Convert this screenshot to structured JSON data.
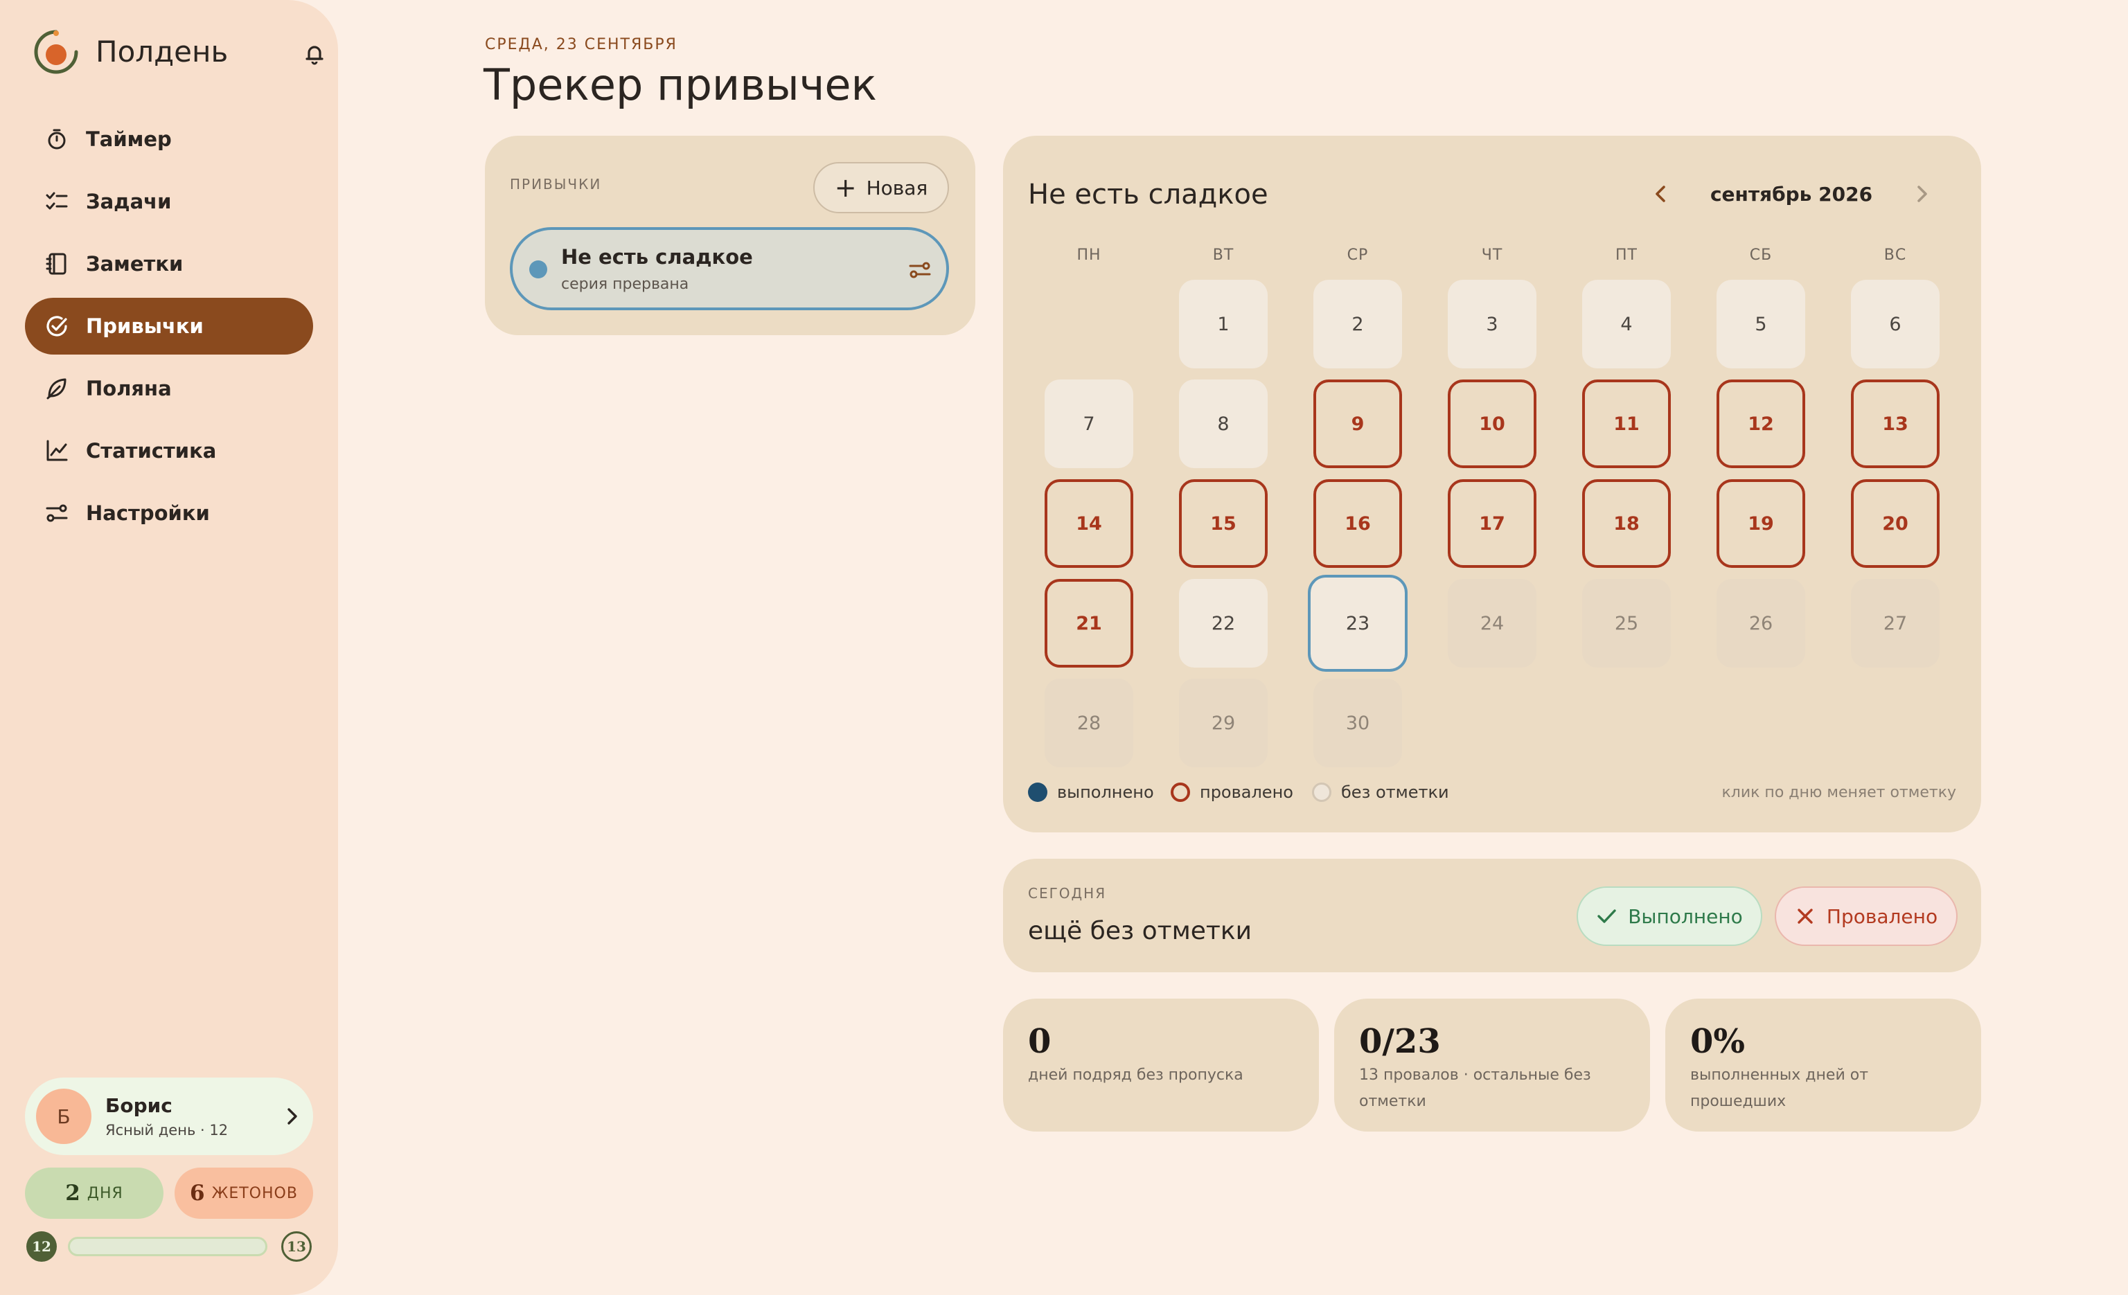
{
  "sidebar": {
    "brand": "Полдень",
    "nav": [
      {
        "label": "Таймер",
        "icon": "stopwatch-icon",
        "active": false
      },
      {
        "label": "Задачи",
        "icon": "checklist-icon",
        "active": false
      },
      {
        "label": "Заметки",
        "icon": "notebook-icon",
        "active": false
      },
      {
        "label": "Привычки",
        "icon": "check-circle-icon",
        "active": true
      },
      {
        "label": "Поляна",
        "icon": "leaf-icon",
        "active": false
      },
      {
        "label": "Статистика",
        "icon": "line-chart-icon",
        "active": false
      },
      {
        "label": "Настройки",
        "icon": "sliders-icon",
        "active": false
      }
    ],
    "user": {
      "initial": "Б",
      "name": "Борис",
      "subtitle": "Ясный день · 12"
    },
    "streak": {
      "number": "2",
      "label": "дня"
    },
    "tokens": {
      "number": "6",
      "label": "жетонов"
    },
    "level": {
      "current": "12",
      "next": "13",
      "progress": 0.0
    }
  },
  "header": {
    "date": "Среда, 23 сентября",
    "title": "Трекер привычек"
  },
  "habits": {
    "caption": "Привычки",
    "new_button": "Новая",
    "items": [
      {
        "name": "Не есть сладкое",
        "status": "серия прервана"
      }
    ]
  },
  "calendar": {
    "habit": "Не есть сладкое",
    "month": "сентябрь 2026",
    "weekdays": [
      "пн",
      "вт",
      "ср",
      "чт",
      "пт",
      "сб",
      "вс"
    ],
    "first_weekday_offset": 1,
    "days": [
      {
        "d": "1",
        "state": "none"
      },
      {
        "d": "2",
        "state": "none"
      },
      {
        "d": "3",
        "state": "none"
      },
      {
        "d": "4",
        "state": "none"
      },
      {
        "d": "5",
        "state": "none"
      },
      {
        "d": "6",
        "state": "none"
      },
      {
        "d": "7",
        "state": "none"
      },
      {
        "d": "8",
        "state": "none"
      },
      {
        "d": "9",
        "state": "failed"
      },
      {
        "d": "10",
        "state": "failed"
      },
      {
        "d": "11",
        "state": "failed"
      },
      {
        "d": "12",
        "state": "failed"
      },
      {
        "d": "13",
        "state": "failed"
      },
      {
        "d": "14",
        "state": "failed"
      },
      {
        "d": "15",
        "state": "failed"
      },
      {
        "d": "16",
        "state": "failed"
      },
      {
        "d": "17",
        "state": "failed"
      },
      {
        "d": "18",
        "state": "failed"
      },
      {
        "d": "19",
        "state": "failed"
      },
      {
        "d": "20",
        "state": "failed"
      },
      {
        "d": "21",
        "state": "failed"
      },
      {
        "d": "22",
        "state": "none"
      },
      {
        "d": "23",
        "state": "today"
      },
      {
        "d": "24",
        "state": "future"
      },
      {
        "d": "25",
        "state": "future"
      },
      {
        "d": "26",
        "state": "future"
      },
      {
        "d": "27",
        "state": "future"
      },
      {
        "d": "28",
        "state": "future"
      },
      {
        "d": "29",
        "state": "future"
      },
      {
        "d": "30",
        "state": "future"
      }
    ],
    "legend": {
      "done": "выполнено",
      "failed": "провалено",
      "none": "без отметки",
      "hint": "клик по дню меняет отметку"
    }
  },
  "today": {
    "caption": "Сегодня",
    "status": "ещё без отметки",
    "done_button": "Выполнено",
    "fail_button": "Провалено"
  },
  "stats": [
    {
      "value": "0",
      "desc": "дней подряд без пропуска"
    },
    {
      "value": "0/23",
      "desc": "13 провалов · остальные без отметки"
    },
    {
      "value": "0%",
      "desc": "выполненных дней от прошедших"
    }
  ],
  "colors": {
    "accent": "#8a4a1e",
    "failed": "#a8361c",
    "today_border": "#5d97b9",
    "done": "#1f4e6f"
  }
}
